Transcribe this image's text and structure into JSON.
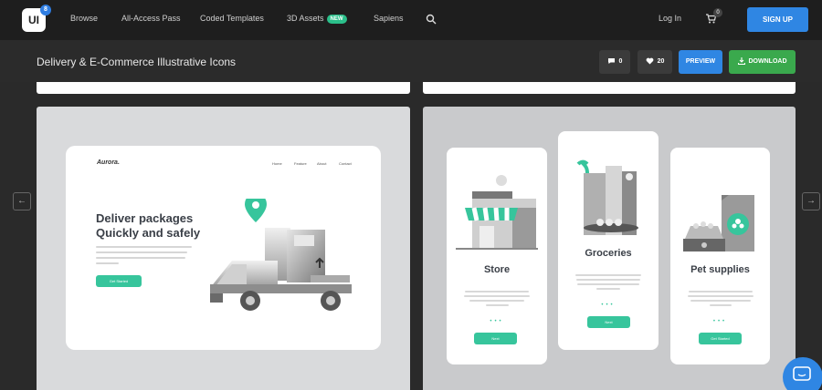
{
  "nav": {
    "logo": "UI",
    "logo_badge": "8",
    "items": [
      "Browse",
      "All-Access Pass",
      "Coded Templates",
      "3D Assets",
      "Sapiens"
    ],
    "new_badge": "NEW",
    "login": "Log In",
    "cart_count": "0",
    "signup": "SIGN UP"
  },
  "header": {
    "title": "Delivery & E-Commerce Illustrative Icons",
    "comments": "0",
    "likes": "20",
    "preview": "PREVIEW",
    "download": "DOWNLOAD"
  },
  "left_preview": {
    "brand": "Aurora.",
    "menu": [
      "Home",
      "Feature",
      "About",
      "Contact"
    ],
    "headline": "Deliver packages Quickly and safely",
    "cta": "Get Started"
  },
  "right_preview": {
    "phones": [
      {
        "label": "Store",
        "button": "Next"
      },
      {
        "label": "Groceries",
        "button": "Next"
      },
      {
        "label": "Pet supplies",
        "button": "Get Started"
      }
    ]
  },
  "colors": {
    "accent_blue": "#2f86e3",
    "accent_green": "#3aa94d",
    "mint": "#37c59c"
  }
}
